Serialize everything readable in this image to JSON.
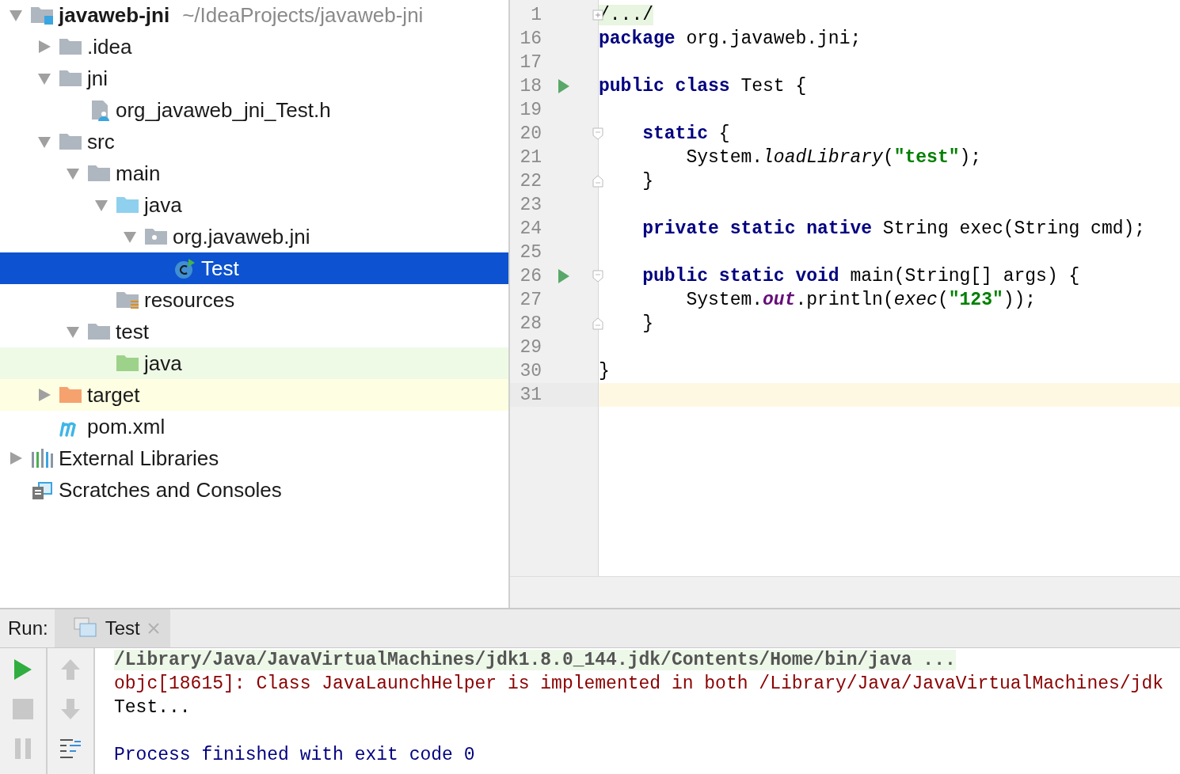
{
  "project_tree": {
    "items": [
      {
        "label": "javaweb-jni",
        "path": "~/IdeaProjects/javaweb-jni",
        "kind": "module",
        "expanded": true,
        "selected": false,
        "children": [
          {
            "label": ".idea",
            "kind": "folder",
            "expanded": false,
            "selected": false
          },
          {
            "label": "jni",
            "kind": "folder",
            "expanded": true,
            "selected": false,
            "children": [
              {
                "label": "org_javaweb_jni_Test.h",
                "kind": "header",
                "selected": false
              }
            ]
          },
          {
            "label": "src",
            "kind": "folder",
            "expanded": true,
            "selected": false,
            "children": [
              {
                "label": "main",
                "kind": "folder",
                "expanded": true,
                "selected": false,
                "children": [
                  {
                    "label": "java",
                    "kind": "source",
                    "expanded": true,
                    "selected": false,
                    "children": [
                      {
                        "label": "org.javaweb.jni",
                        "kind": "package",
                        "expanded": true,
                        "selected": false,
                        "children": [
                          {
                            "label": "Test",
                            "kind": "class",
                            "selected": true
                          }
                        ]
                      }
                    ]
                  },
                  {
                    "label": "resources",
                    "kind": "resources",
                    "selected": false
                  }
                ]
              },
              {
                "label": "test",
                "kind": "folder",
                "expanded": true,
                "selected": false,
                "children": [
                  {
                    "label": "java",
                    "kind": "test-source",
                    "selected": false,
                    "color": "#eefae6"
                  }
                ]
              }
            ]
          },
          {
            "label": "target",
            "kind": "excluded",
            "expanded": false,
            "selected": false,
            "color": "#fefee2"
          },
          {
            "label": "pom.xml",
            "kind": "maven",
            "selected": false
          }
        ]
      },
      {
        "label": "External Libraries",
        "kind": "libraries",
        "expanded": false,
        "selected": false
      },
      {
        "label": "Scratches and Consoles",
        "kind": "scratches",
        "selected": false
      }
    ]
  },
  "editor": {
    "lines": [
      {
        "number": "1",
        "current": false,
        "gutter": [
          {
            "kind": "fold-collapsed"
          }
        ],
        "tokens": [
          {
            "kind": "folded",
            "text": "/.../"
          }
        ]
      },
      {
        "number": "16",
        "current": false,
        "tokens": [
          {
            "kind": "keyword",
            "text": "package"
          },
          {
            "kind": "plain",
            "text": " org.javaweb.jni;"
          }
        ]
      },
      {
        "number": "17",
        "current": false
      },
      {
        "number": "18",
        "current": false,
        "gutter": [
          {
            "kind": "run"
          }
        ],
        "tokens": [
          {
            "kind": "keyword",
            "text": "public class"
          },
          {
            "kind": "plain",
            "text": " Test {"
          }
        ]
      },
      {
        "number": "19",
        "current": false
      },
      {
        "number": "20",
        "current": false,
        "gutter": [
          {
            "kind": "fold-start"
          }
        ],
        "tokens": [
          {
            "kind": "keyword",
            "text": "    static"
          },
          {
            "kind": "plain",
            "text": " {"
          }
        ]
      },
      {
        "number": "21",
        "current": false,
        "tokens": [
          {
            "kind": "plain",
            "text": "        System."
          },
          {
            "kind": "italic",
            "text": "loadLibrary"
          },
          {
            "kind": "plain",
            "text": "("
          },
          {
            "kind": "string",
            "text": "\"test\""
          },
          {
            "kind": "plain",
            "text": ");"
          }
        ]
      },
      {
        "number": "22",
        "current": false,
        "gutter": [
          {
            "kind": "fold-end"
          }
        ],
        "tokens": [
          {
            "kind": "plain",
            "text": "    }"
          }
        ]
      },
      {
        "number": "23",
        "current": false
      },
      {
        "number": "24",
        "current": false,
        "tokens": [
          {
            "kind": "keyword",
            "text": "    private static native"
          },
          {
            "kind": "plain",
            "text": " String exec(String cmd);"
          }
        ]
      },
      {
        "number": "25",
        "current": false
      },
      {
        "number": "26",
        "current": false,
        "gutter": [
          {
            "kind": "run"
          },
          {
            "kind": "fold-start"
          }
        ],
        "tokens": [
          {
            "kind": "keyword",
            "text": "    public static void"
          },
          {
            "kind": "plain",
            "text": " main(String[] args) {"
          }
        ]
      },
      {
        "number": "27",
        "current": false,
        "tokens": [
          {
            "kind": "plain",
            "text": "        System."
          },
          {
            "kind": "field",
            "text": "out"
          },
          {
            "kind": "plain",
            "text": ".println("
          },
          {
            "kind": "italic",
            "text": "exec"
          },
          {
            "kind": "plain",
            "text": "("
          },
          {
            "kind": "string",
            "text": "\"123\""
          },
          {
            "kind": "plain",
            "text": "));"
          }
        ]
      },
      {
        "number": "28",
        "current": false,
        "gutter": [
          {
            "kind": "fold-end"
          }
        ],
        "tokens": [
          {
            "kind": "plain",
            "text": "    }"
          }
        ]
      },
      {
        "number": "29",
        "current": false
      },
      {
        "number": "30",
        "current": false,
        "tokens": [
          {
            "kind": "plain",
            "text": "}"
          }
        ]
      },
      {
        "number": "31",
        "current": true
      }
    ]
  },
  "run_panel": {
    "label": "Run:",
    "tabs": [
      {
        "label": "Test",
        "selected": true
      }
    ],
    "toolbar": [
      {
        "kind": "run",
        "disabled": false
      },
      {
        "kind": "up",
        "disabled": true
      },
      {
        "kind": "stop",
        "disabled": true
      },
      {
        "kind": "down",
        "disabled": true
      },
      {
        "kind": "pause",
        "disabled": true
      },
      {
        "kind": "wrap",
        "disabled": false
      }
    ],
    "console": [
      {
        "kind": "command",
        "text": "/Library/Java/JavaVirtualMachines/jdk1.8.0_144.jdk/Contents/Home/bin/java ..."
      },
      {
        "kind": "error",
        "text": "objc[18615]: Class JavaLaunchHelper is implemented in both /Library/Java/JavaVirtualMachines/jdk"
      },
      {
        "kind": "output",
        "text": "Test..."
      },
      {
        "kind": "blank"
      },
      {
        "kind": "system",
        "text": "Process finished with exit code 0"
      }
    ]
  }
}
